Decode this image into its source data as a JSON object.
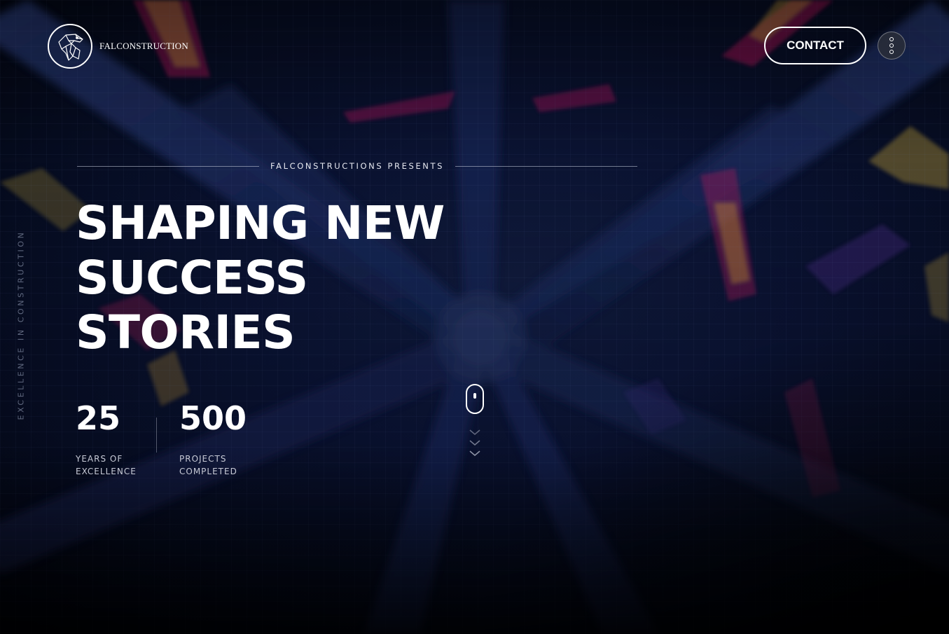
{
  "header": {
    "logo_text": "FALCONSTRUCTION",
    "contact_label": "CONTACT"
  },
  "side": {
    "tagline": "EXCELLENCE IN CONSTRUCTION"
  },
  "hero": {
    "presents": "FALCONSTRUCTIONS PRESENTS",
    "headline_lines": [
      "SHAPING NEW",
      "SUCCESS",
      "STORIES"
    ]
  },
  "stats": [
    {
      "value": "25",
      "label_line1": "YEARS OF",
      "label_line2": "EXCELLENCE"
    },
    {
      "value": "500",
      "label_line1": "PROJECTS",
      "label_line2": "COMPLETED"
    }
  ],
  "icons": {
    "logo": "falcon-logo-icon",
    "menu": "vertical-dots-icon",
    "scroll": "mouse-scroll-icon",
    "chevrons": "chevron-down-icon"
  },
  "colors": {
    "background": "#070d22",
    "text": "#ffffff",
    "muted": "#c7cad6"
  }
}
